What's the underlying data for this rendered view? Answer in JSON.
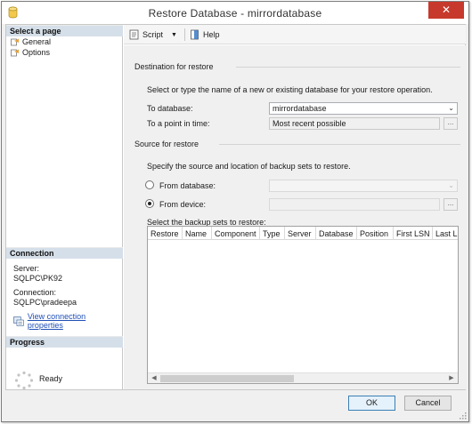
{
  "window": {
    "title": "Restore Database - mirrordatabase",
    "close_glyph": "✕"
  },
  "left": {
    "select_page_header": "Select a page",
    "pages": [
      {
        "label": "General",
        "icon": "page-settings-icon"
      },
      {
        "label": "Options",
        "icon": "page-settings-icon"
      }
    ],
    "connection_header": "Connection",
    "server_label": "Server:",
    "server_value": "SQLPC\\PK92",
    "connection_label": "Connection:",
    "connection_value": "SQLPC\\pradeepa",
    "view_connection_link": "View connection properties",
    "progress_header": "Progress",
    "progress_status": "Ready"
  },
  "toolbar": {
    "script_label": "Script",
    "help_label": "Help"
  },
  "destination": {
    "group_label": "Destination for restore",
    "description": "Select or type the name of a new or existing database for your restore operation.",
    "to_database_label": "To database:",
    "to_database_value": "mirrordatabase",
    "point_in_time_label": "To a point in time:",
    "point_in_time_value": "Most recent possible",
    "ellipsis": "..."
  },
  "source": {
    "group_label": "Source for restore",
    "description": "Specify the source and location of backup sets to restore.",
    "from_database_label": "From database:",
    "from_database_selected": false,
    "from_device_label": "From device:",
    "from_device_selected": true,
    "ellipsis": "..."
  },
  "backup_sets": {
    "label": "Select the backup sets to restore:",
    "columns": [
      "Restore",
      "Name",
      "Component",
      "Type",
      "Server",
      "Database",
      "Position",
      "First LSN",
      "Last LSN"
    ],
    "rows": []
  },
  "footer": {
    "ok_label": "OK",
    "cancel_label": "Cancel"
  },
  "colors": {
    "close_button": "#c7392c",
    "section_header": "#d5dfe9",
    "link": "#1f4fb5",
    "accent_border": "#3c7fb1"
  }
}
